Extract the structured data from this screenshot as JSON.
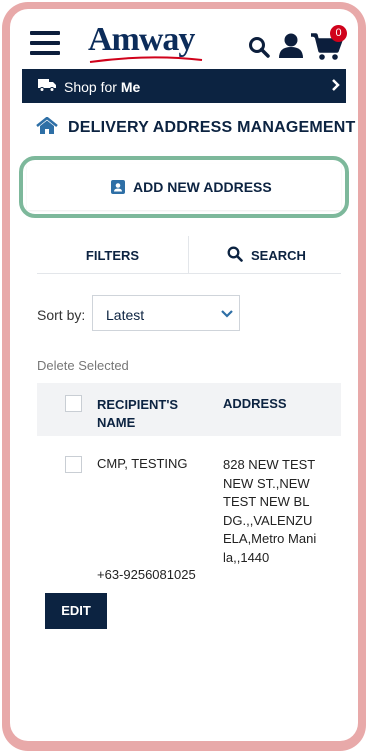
{
  "header": {
    "logo": "Amway",
    "cart_count": "0"
  },
  "shop_bar": {
    "prefix": "Shop for",
    "target": "Me"
  },
  "page": {
    "title": "DELIVERY ADDRESS MANAGEMENT"
  },
  "actions": {
    "add_new_address": "ADD NEW ADDRESS",
    "filters": "FILTERS",
    "search": "SEARCH",
    "delete_selected": "Delete Selected",
    "edit": "EDIT"
  },
  "sort": {
    "label": "Sort by:",
    "selected": "Latest"
  },
  "table": {
    "columns": [
      "RECIPIENT'S NAME",
      "ADDRESS"
    ],
    "rows": [
      {
        "name": "CMP, TESTING",
        "address": "828 NEW TEST NEW ST.,NEW TEST NEW BLDG.,,VALENZUELA,Metro Manila,,1440",
        "phone": "+63-9256081025"
      }
    ]
  },
  "colors": {
    "brand_navy": "#0c2341",
    "highlight_green": "#7db89b",
    "frame_pink": "#e8a9a9",
    "badge_red": "#d0021b"
  },
  "icons": [
    "hamburger-icon",
    "search-icon",
    "account-icon",
    "cart-icon",
    "truck-icon",
    "chevron-right-icon",
    "home-icon",
    "address-card-icon",
    "chevron-down-icon"
  ]
}
